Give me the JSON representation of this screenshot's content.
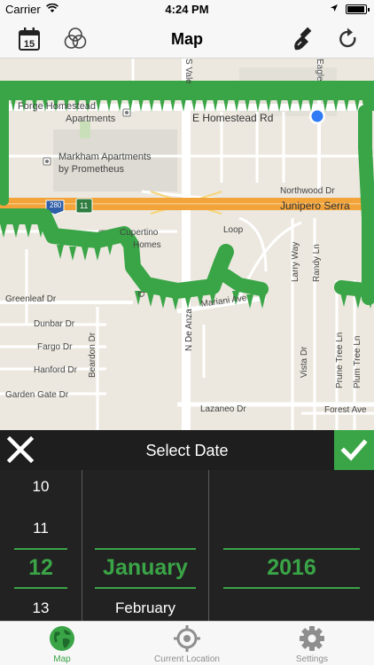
{
  "status_bar": {
    "carrier": "Carrier",
    "time": "4:24 PM",
    "battery_level": 0.95
  },
  "nav": {
    "title": "Map",
    "left_icons": [
      "calendar-15-icon",
      "color-circles-icon"
    ],
    "right_icons": [
      "brush-icon",
      "refresh-icon"
    ]
  },
  "map": {
    "labels": {
      "forge_homestead": "Forge Homestead",
      "apartments": "Apartments",
      "e_homestead_rd": "E Homestead Rd",
      "markham_1": "Markham Apartments",
      "markham_2": "by Prometheus",
      "northwood_dr": "Northwood Dr",
      "junipero_serra": "Junipero Serra",
      "cupertino_1": "Cupertino",
      "cupertino_2": "Homes",
      "loop": "Loop",
      "larry_way": "Larry Way",
      "randy_ln": "Randy Ln",
      "greenleaf_dr": "Greenleaf Dr",
      "mariani_ave": "Mariani Ave",
      "dunbar_dr": "Dunbar Dr",
      "fargo_dr": "Fargo Dr",
      "beardon_dr": "Beardon Dr",
      "hanford_dr": "Hanford Dr",
      "garden_gate_dr": "Garden Gate Dr",
      "lazaneo_dr": "Lazaneo Dr",
      "forest_ave": "Forest Ave",
      "vista_dr": "Vista Dr",
      "prune_tree_ln": "Prune Tree Ln",
      "plum_tree_ln": "Plum Tree Ln",
      "n_de_anza": "N De Anza",
      "s_vale": "S Vale",
      "eagle": "Eagle",
      "highway_shield": "11",
      "d_blvd": "D",
      "interstate": "280"
    },
    "track_color": "#3aa547",
    "location_color": "#2f7cf6"
  },
  "picker": {
    "title": "Select Date",
    "days": [
      "10",
      "11",
      "12",
      "13"
    ],
    "selected_day": "12",
    "months": [
      "January",
      "February"
    ],
    "selected_month": "January",
    "year": "2016",
    "accent": "#3aa547"
  },
  "tabs": [
    {
      "label": "Map",
      "icon": "globe-icon",
      "active": true
    },
    {
      "label": "Current Location",
      "icon": "crosshair-icon",
      "active": false
    },
    {
      "label": "Settings",
      "icon": "gear-icon",
      "active": false
    }
  ]
}
